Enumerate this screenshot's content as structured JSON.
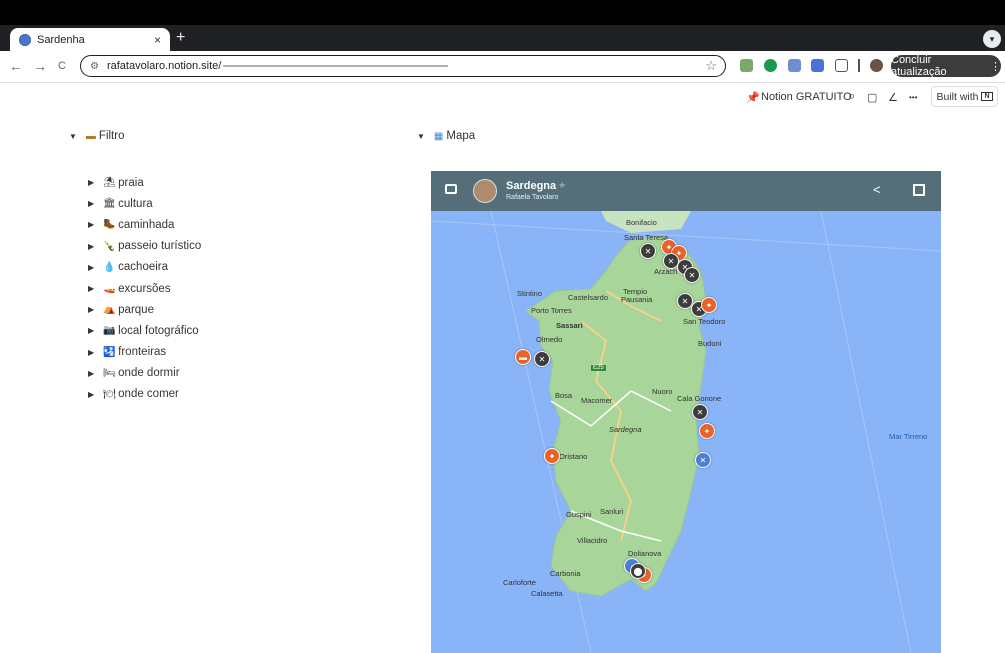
{
  "browser": {
    "tab_title": "Sardenha",
    "close_glyph": "×",
    "new_tab_glyph": "+",
    "url": "rafatavolaro.notion.site/",
    "update_label": "Concluir atualização",
    "update_menu_glyph": "⋮",
    "nav": {
      "back": "←",
      "forward": "→",
      "reload": "C"
    }
  },
  "notion_bar": {
    "pin_label": "Notion GRATUITO",
    "search_glyph": "⌕",
    "comment_glyph": "▢",
    "edit_glyph": "∠",
    "more_glyph": "•••",
    "built_with": "Built with",
    "built_with_logo": "N"
  },
  "filtro": {
    "title": "Filtro",
    "items": [
      {
        "emoji": "⛱",
        "label": "praia"
      },
      {
        "emoji": "🏛",
        "label": "cultura"
      },
      {
        "emoji": "🥾",
        "label": "caminhada"
      },
      {
        "emoji": "🍾",
        "label": "passeio turístico"
      },
      {
        "emoji": "💧",
        "label": "cachoeira"
      },
      {
        "emoji": "🚤",
        "label": "excursões"
      },
      {
        "emoji": "⛺",
        "label": "parque"
      },
      {
        "emoji": "📷",
        "label": "local fotográfico"
      },
      {
        "emoji": "🛂",
        "label": "fronteiras"
      },
      {
        "emoji": "🛏",
        "label": "onde dormir"
      },
      {
        "emoji": "🍽",
        "label": "onde comer"
      }
    ]
  },
  "mapa": {
    "title": "Mapa",
    "map_title": "Sardegna",
    "map_subtitle": "Rafaela Tavolaro",
    "labels": {
      "bonifacio": "Bonifacio",
      "santa_teresa": "Santa Teresa",
      "arzachena": "Arzach",
      "stintino": "Stintino",
      "castelsardo": "Castelsardo",
      "tempio": "Tempio",
      "pausania": "Pausania",
      "porto_torres": "Porto Torres",
      "sassari": "Sassari",
      "san_teodoro": "San Teodoro",
      "olmedo": "Olmedo",
      "budoni": "Budoni",
      "e25": "E25",
      "bosa": "Bosa",
      "macomer": "Macomer",
      "nuoro": "Nuoro",
      "cala_gonone": "Cala Gonone",
      "sardegna": "Sardegna",
      "mar_tirreno": "Mar Tirreno",
      "oristano": "Oristano",
      "guspini": "Guspini",
      "sanluri": "Sanluri",
      "villacidro": "Villacidro",
      "dolianova": "Dolianova",
      "carbonia": "Carbonia",
      "carloforte": "Carloforte",
      "calasetta": "Calasetta"
    }
  }
}
